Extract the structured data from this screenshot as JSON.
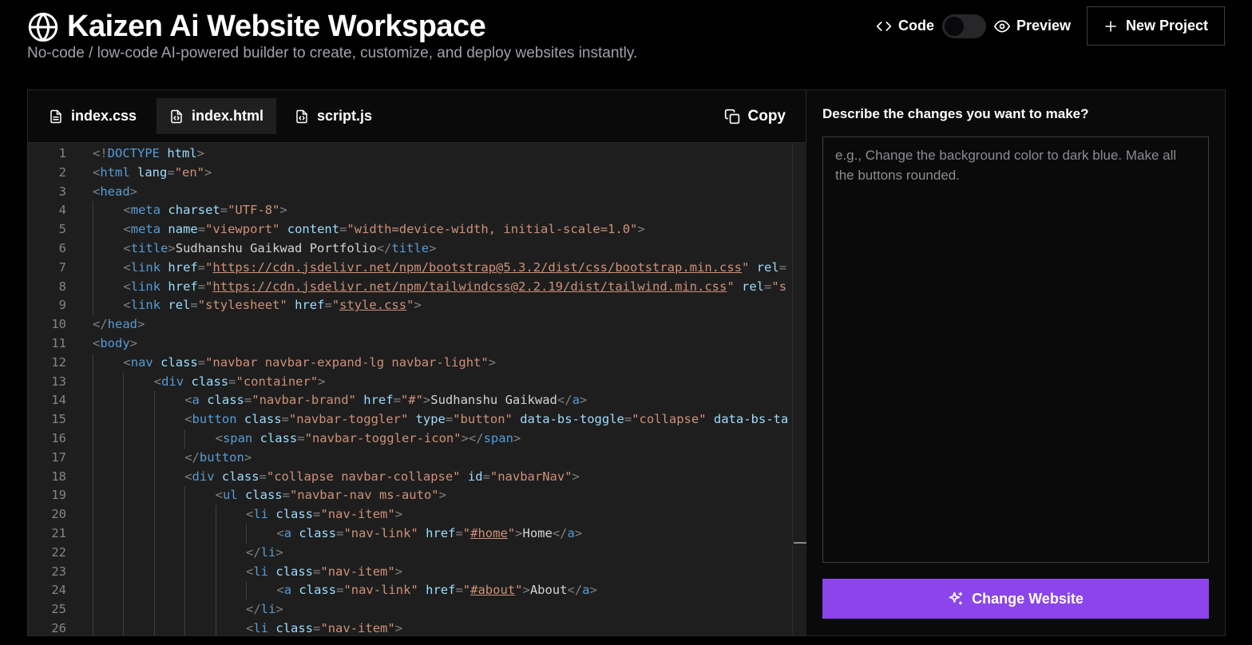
{
  "header": {
    "title": "Kaizen Ai Website Workspace",
    "subtitle": "No-code / low-code AI-powered builder to create, customize, and deploy websites instantly.",
    "logo_icon": "globe-icon"
  },
  "view_toggle": {
    "code_label": "Code",
    "preview_label": "Preview",
    "mode": "code"
  },
  "new_project_label": "New Project",
  "editor": {
    "tabs": [
      {
        "label": "index.css",
        "icon": "file-text-icon",
        "active": false
      },
      {
        "label": "index.html",
        "icon": "file-code-icon",
        "active": true
      },
      {
        "label": "script.js",
        "icon": "file-code-icon",
        "active": false
      }
    ],
    "copy_label": "Copy",
    "lines": [
      {
        "n": "1",
        "indent": 0,
        "tokens": [
          [
            "p",
            "<!"
          ],
          [
            "tag",
            "DOCTYPE"
          ],
          [
            "p",
            " "
          ],
          [
            "attr",
            "html"
          ],
          [
            "p",
            ">"
          ]
        ]
      },
      {
        "n": "2",
        "indent": 0,
        "tokens": [
          [
            "p",
            "<"
          ],
          [
            "tag",
            "html"
          ],
          [
            "p",
            " "
          ],
          [
            "attr",
            "lang"
          ],
          [
            "p",
            "="
          ],
          [
            "str",
            "\"en\""
          ],
          [
            "p",
            ">"
          ]
        ]
      },
      {
        "n": "3",
        "indent": 0,
        "tokens": [
          [
            "p",
            "<"
          ],
          [
            "tag",
            "head"
          ],
          [
            "p",
            ">"
          ]
        ]
      },
      {
        "n": "4",
        "indent": 1,
        "tokens": [
          [
            "p",
            "<"
          ],
          [
            "tag",
            "meta"
          ],
          [
            "p",
            " "
          ],
          [
            "attr",
            "charset"
          ],
          [
            "p",
            "="
          ],
          [
            "str",
            "\"UTF-8\""
          ],
          [
            "p",
            ">"
          ]
        ]
      },
      {
        "n": "5",
        "indent": 1,
        "tokens": [
          [
            "p",
            "<"
          ],
          [
            "tag",
            "meta"
          ],
          [
            "p",
            " "
          ],
          [
            "attr",
            "name"
          ],
          [
            "p",
            "="
          ],
          [
            "str",
            "\"viewport\""
          ],
          [
            "p",
            " "
          ],
          [
            "attr",
            "content"
          ],
          [
            "p",
            "="
          ],
          [
            "str",
            "\"width=device-width, initial-scale=1.0\""
          ],
          [
            "p",
            ">"
          ]
        ]
      },
      {
        "n": "6",
        "indent": 1,
        "tokens": [
          [
            "p",
            "<"
          ],
          [
            "tag",
            "title"
          ],
          [
            "p",
            ">"
          ],
          [
            "text",
            "Sudhanshu Gaikwad Portfolio"
          ],
          [
            "p",
            "</"
          ],
          [
            "tag",
            "title"
          ],
          [
            "p",
            ">"
          ]
        ]
      },
      {
        "n": "7",
        "indent": 1,
        "tokens": [
          [
            "p",
            "<"
          ],
          [
            "tag",
            "link"
          ],
          [
            "p",
            " "
          ],
          [
            "attr",
            "href"
          ],
          [
            "p",
            "="
          ],
          [
            "str",
            "\""
          ],
          [
            "url",
            "https://cdn.jsdelivr.net/npm/bootstrap@5.3.2/dist/css/bootstrap.min.css"
          ],
          [
            "str",
            "\""
          ],
          [
            "p",
            " "
          ],
          [
            "attr",
            "rel"
          ],
          [
            "p",
            "="
          ]
        ]
      },
      {
        "n": "8",
        "indent": 1,
        "tokens": [
          [
            "p",
            "<"
          ],
          [
            "tag",
            "link"
          ],
          [
            "p",
            " "
          ],
          [
            "attr",
            "href"
          ],
          [
            "p",
            "="
          ],
          [
            "str",
            "\""
          ],
          [
            "url",
            "https://cdn.jsdelivr.net/npm/tailwindcss@2.2.19/dist/tailwind.min.css"
          ],
          [
            "str",
            "\""
          ],
          [
            "p",
            " "
          ],
          [
            "attr",
            "rel"
          ],
          [
            "p",
            "="
          ],
          [
            "str",
            "\"s"
          ]
        ]
      },
      {
        "n": "9",
        "indent": 1,
        "tokens": [
          [
            "p",
            "<"
          ],
          [
            "tag",
            "link"
          ],
          [
            "p",
            " "
          ],
          [
            "attr",
            "rel"
          ],
          [
            "p",
            "="
          ],
          [
            "str",
            "\"stylesheet\""
          ],
          [
            "p",
            " "
          ],
          [
            "attr",
            "href"
          ],
          [
            "p",
            "="
          ],
          [
            "str",
            "\""
          ],
          [
            "url",
            "style.css"
          ],
          [
            "str",
            "\""
          ],
          [
            "p",
            ">"
          ]
        ]
      },
      {
        "n": "10",
        "indent": 0,
        "tokens": [
          [
            "p",
            "</"
          ],
          [
            "tag",
            "head"
          ],
          [
            "p",
            ">"
          ]
        ]
      },
      {
        "n": "11",
        "indent": 0,
        "tokens": [
          [
            "p",
            "<"
          ],
          [
            "tag",
            "body"
          ],
          [
            "p",
            ">"
          ]
        ]
      },
      {
        "n": "12",
        "indent": 1,
        "tokens": [
          [
            "p",
            "<"
          ],
          [
            "tag",
            "nav"
          ],
          [
            "p",
            " "
          ],
          [
            "attr",
            "class"
          ],
          [
            "p",
            "="
          ],
          [
            "str",
            "\"navbar navbar-expand-lg navbar-light\""
          ],
          [
            "p",
            ">"
          ]
        ]
      },
      {
        "n": "13",
        "indent": 2,
        "tokens": [
          [
            "p",
            "<"
          ],
          [
            "tag",
            "div"
          ],
          [
            "p",
            " "
          ],
          [
            "attr",
            "class"
          ],
          [
            "p",
            "="
          ],
          [
            "str",
            "\"container\""
          ],
          [
            "p",
            ">"
          ]
        ]
      },
      {
        "n": "14",
        "indent": 3,
        "tokens": [
          [
            "p",
            "<"
          ],
          [
            "tag",
            "a"
          ],
          [
            "p",
            " "
          ],
          [
            "attr",
            "class"
          ],
          [
            "p",
            "="
          ],
          [
            "str",
            "\"navbar-brand\""
          ],
          [
            "p",
            " "
          ],
          [
            "attr",
            "href"
          ],
          [
            "p",
            "="
          ],
          [
            "str",
            "\"#\""
          ],
          [
            "p",
            ">"
          ],
          [
            "text",
            "Sudhanshu Gaikwad"
          ],
          [
            "p",
            "</"
          ],
          [
            "tag",
            "a"
          ],
          [
            "p",
            ">"
          ]
        ]
      },
      {
        "n": "15",
        "indent": 3,
        "tokens": [
          [
            "p",
            "<"
          ],
          [
            "tag",
            "button"
          ],
          [
            "p",
            " "
          ],
          [
            "attr",
            "class"
          ],
          [
            "p",
            "="
          ],
          [
            "str",
            "\"navbar-toggler\""
          ],
          [
            "p",
            " "
          ],
          [
            "attr",
            "type"
          ],
          [
            "p",
            "="
          ],
          [
            "str",
            "\"button\""
          ],
          [
            "p",
            " "
          ],
          [
            "attr",
            "data-bs-toggle"
          ],
          [
            "p",
            "="
          ],
          [
            "str",
            "\"collapse\""
          ],
          [
            "p",
            " "
          ],
          [
            "attr",
            "data-bs-ta"
          ]
        ]
      },
      {
        "n": "16",
        "indent": 4,
        "tokens": [
          [
            "p",
            "<"
          ],
          [
            "tag",
            "span"
          ],
          [
            "p",
            " "
          ],
          [
            "attr",
            "class"
          ],
          [
            "p",
            "="
          ],
          [
            "str",
            "\"navbar-toggler-icon\""
          ],
          [
            "p",
            "></"
          ],
          [
            "tag",
            "span"
          ],
          [
            "p",
            ">"
          ]
        ]
      },
      {
        "n": "17",
        "indent": 3,
        "tokens": [
          [
            "p",
            "</"
          ],
          [
            "tag",
            "button"
          ],
          [
            "p",
            ">"
          ]
        ]
      },
      {
        "n": "18",
        "indent": 3,
        "tokens": [
          [
            "p",
            "<"
          ],
          [
            "tag",
            "div"
          ],
          [
            "p",
            " "
          ],
          [
            "attr",
            "class"
          ],
          [
            "p",
            "="
          ],
          [
            "str",
            "\"collapse navbar-collapse\""
          ],
          [
            "p",
            " "
          ],
          [
            "attr",
            "id"
          ],
          [
            "p",
            "="
          ],
          [
            "str",
            "\"navbarNav\""
          ],
          [
            "p",
            ">"
          ]
        ]
      },
      {
        "n": "19",
        "indent": 4,
        "tokens": [
          [
            "p",
            "<"
          ],
          [
            "tag",
            "ul"
          ],
          [
            "p",
            " "
          ],
          [
            "attr",
            "class"
          ],
          [
            "p",
            "="
          ],
          [
            "str",
            "\"navbar-nav ms-auto\""
          ],
          [
            "p",
            ">"
          ]
        ]
      },
      {
        "n": "20",
        "indent": 5,
        "tokens": [
          [
            "p",
            "<"
          ],
          [
            "tag",
            "li"
          ],
          [
            "p",
            " "
          ],
          [
            "attr",
            "class"
          ],
          [
            "p",
            "="
          ],
          [
            "str",
            "\"nav-item\""
          ],
          [
            "p",
            ">"
          ]
        ]
      },
      {
        "n": "21",
        "indent": 6,
        "tokens": [
          [
            "p",
            "<"
          ],
          [
            "tag",
            "a"
          ],
          [
            "p",
            " "
          ],
          [
            "attr",
            "class"
          ],
          [
            "p",
            "="
          ],
          [
            "str",
            "\"nav-link\""
          ],
          [
            "p",
            " "
          ],
          [
            "attr",
            "href"
          ],
          [
            "p",
            "="
          ],
          [
            "str",
            "\""
          ],
          [
            "url",
            "#home"
          ],
          [
            "str",
            "\""
          ],
          [
            "p",
            ">"
          ],
          [
            "text",
            "Home"
          ],
          [
            "p",
            "</"
          ],
          [
            "tag",
            "a"
          ],
          [
            "p",
            ">"
          ]
        ]
      },
      {
        "n": "22",
        "indent": 5,
        "tokens": [
          [
            "p",
            "</"
          ],
          [
            "tag",
            "li"
          ],
          [
            "p",
            ">"
          ]
        ]
      },
      {
        "n": "23",
        "indent": 5,
        "tokens": [
          [
            "p",
            "<"
          ],
          [
            "tag",
            "li"
          ],
          [
            "p",
            " "
          ],
          [
            "attr",
            "class"
          ],
          [
            "p",
            "="
          ],
          [
            "str",
            "\"nav-item\""
          ],
          [
            "p",
            ">"
          ]
        ]
      },
      {
        "n": "24",
        "indent": 6,
        "tokens": [
          [
            "p",
            "<"
          ],
          [
            "tag",
            "a"
          ],
          [
            "p",
            " "
          ],
          [
            "attr",
            "class"
          ],
          [
            "p",
            "="
          ],
          [
            "str",
            "\"nav-link\""
          ],
          [
            "p",
            " "
          ],
          [
            "attr",
            "href"
          ],
          [
            "p",
            "="
          ],
          [
            "str",
            "\""
          ],
          [
            "url",
            "#about"
          ],
          [
            "str",
            "\""
          ],
          [
            "p",
            ">"
          ],
          [
            "text",
            "About"
          ],
          [
            "p",
            "</"
          ],
          [
            "tag",
            "a"
          ],
          [
            "p",
            ">"
          ]
        ]
      },
      {
        "n": "25",
        "indent": 5,
        "tokens": [
          [
            "p",
            "</"
          ],
          [
            "tag",
            "li"
          ],
          [
            "p",
            ">"
          ]
        ]
      },
      {
        "n": "26",
        "indent": 5,
        "tokens": [
          [
            "p",
            "<"
          ],
          [
            "tag",
            "li"
          ],
          [
            "p",
            " "
          ],
          [
            "attr",
            "class"
          ],
          [
            "p",
            "="
          ],
          [
            "str",
            "\"nav-item\""
          ],
          [
            "p",
            ">"
          ]
        ]
      }
    ]
  },
  "prompt": {
    "label": "Describe the changes you want to make?",
    "placeholder": "e.g., Change the background color to dark blue. Make all the buttons rounded.",
    "value": "",
    "submit_label": "Change Website",
    "submit_icon": "sparkles-icon"
  },
  "colors": {
    "accent": "#8b45ea",
    "editor_bg": "#1e1e1e",
    "tag": "#569cd6",
    "attr": "#9cdcfe",
    "string": "#ce9178"
  }
}
